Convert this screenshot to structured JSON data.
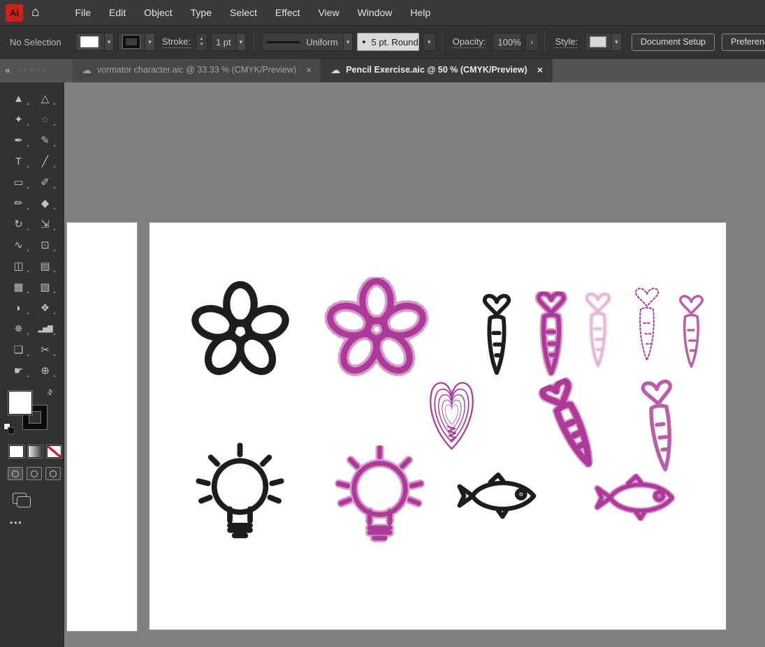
{
  "app": {
    "logo": "Ai",
    "home_glyph": "⌂"
  },
  "colors": {
    "menubar_bg": "#393939",
    "controlbar_bg": "#323232",
    "tabbar_bg": "#535353",
    "panel_bg": "#323232",
    "pasteboard_bg": "#7f7f7f",
    "artboard_bg": "#ffffff",
    "artwork_black": "#1d1d1b",
    "artwork_magenta": "#ad3a98",
    "artwork_pink": "#bb5ea9",
    "artwork_pink_faded": "#d49fca",
    "ai_logo_bg": "#c9251c"
  },
  "menubar": {
    "items": [
      "File",
      "Edit",
      "Object",
      "Type",
      "Select",
      "Effect",
      "View",
      "Window",
      "Help"
    ]
  },
  "control_bar": {
    "selection_status": "No Selection",
    "fill_swatch_color": "#ffffff",
    "stroke_swatch_color": "#000000",
    "stroke_label": "Stroke:",
    "stroke_weight": "1 pt",
    "width_profile": "Uniform",
    "brush_dot": "•",
    "brush_definition": "5 pt. Round",
    "opacity_label": "Opacity:",
    "opacity_value": "100%",
    "style_label": "Style:",
    "document_setup": "Document Setup",
    "preferences": "Preferences",
    "chevron": "▾",
    "spinner_up": "▴",
    "spinner_down": "▾",
    "more_arrow": "›"
  },
  "tab_bar": {
    "collapse": "«",
    "tabs": [
      {
        "icon": "☁",
        "label": "vormator character.aic @ 33.33 % (CMYK/Preview)",
        "close": "×",
        "active": false
      },
      {
        "icon": "☁",
        "label": "Pencil Exercise.aic @ 50 % (CMYK/Preview)",
        "close": "×",
        "active": true
      }
    ]
  },
  "toolbar": {
    "swap_icon": "⇄",
    "edit_toolbar": "•••",
    "tools": [
      {
        "name": "selection-tool",
        "glyph": "▲"
      },
      {
        "name": "direct-selection-tool",
        "glyph": "△"
      },
      {
        "name": "magic-wand-tool",
        "glyph": "✦"
      },
      {
        "name": "lasso-tool",
        "glyph": "◌"
      },
      {
        "name": "pen-tool",
        "glyph": "✒"
      },
      {
        "name": "curvature-tool",
        "glyph": "✎"
      },
      {
        "name": "type-tool",
        "glyph": "T"
      },
      {
        "name": "line-segment-tool",
        "glyph": "╱"
      },
      {
        "name": "rectangle-tool",
        "glyph": "▭"
      },
      {
        "name": "paintbrush-tool",
        "glyph": "✐"
      },
      {
        "name": "pencil-tool",
        "glyph": "✏"
      },
      {
        "name": "eraser-tool",
        "glyph": "◆"
      },
      {
        "name": "rotate-tool",
        "glyph": "↻"
      },
      {
        "name": "scale-tool",
        "glyph": "⇲"
      },
      {
        "name": "width-tool",
        "glyph": "∿"
      },
      {
        "name": "free-transform-tool",
        "glyph": "⊡"
      },
      {
        "name": "shape-builder-tool",
        "glyph": "◫"
      },
      {
        "name": "perspective-grid-tool",
        "glyph": "▤"
      },
      {
        "name": "mesh-tool",
        "glyph": "▦"
      },
      {
        "name": "gradient-tool",
        "glyph": "▧"
      },
      {
        "name": "eyedropper-tool",
        "glyph": "◗"
      },
      {
        "name": "blend-tool",
        "glyph": "❖"
      },
      {
        "name": "symbol-sprayer-tool",
        "glyph": "✵"
      },
      {
        "name": "column-graph-tool",
        "glyph": "▂▅▇"
      },
      {
        "name": "artboard-tool",
        "glyph": "❏"
      },
      {
        "name": "slice-tool",
        "glyph": "✂"
      },
      {
        "name": "hand-tool",
        "glyph": "☛"
      },
      {
        "name": "zoom-tool",
        "glyph": "⊕"
      }
    ]
  },
  "canvas": {
    "artwork": [
      {
        "name": "flower-icon-black",
        "color": "#1d1d1b",
        "style": "solid"
      },
      {
        "name": "flower-icon-magenta",
        "color": "#ad3a98",
        "style": "sketch"
      },
      {
        "name": "carrot-icon-black",
        "color": "#1d1d1b",
        "style": "solid"
      },
      {
        "name": "carrot-icon-magenta",
        "color": "#ad3a98",
        "style": "sketch"
      },
      {
        "name": "carrot-icon-pink-faded",
        "color": "#d49fca",
        "style": "faded"
      },
      {
        "name": "carrot-icon-dashed",
        "color": "#ad3a98",
        "style": "dashed-outline"
      },
      {
        "name": "carrot-icon-pink",
        "color": "#bb5ea9",
        "style": "thin"
      },
      {
        "name": "heart-scribble-icon",
        "color": "#ad3a98",
        "style": "concentric"
      },
      {
        "name": "carrot-icon-magenta-tilted",
        "color": "#ad3a98",
        "style": "dense"
      },
      {
        "name": "carrot-icon-pink-tilted",
        "color": "#bb5ea9",
        "style": "thin"
      },
      {
        "name": "lightbulb-icon-black",
        "color": "#1d1d1b",
        "style": "solid"
      },
      {
        "name": "lightbulb-icon-magenta",
        "color": "#ad3a98",
        "style": "sketch"
      },
      {
        "name": "fish-icon-black",
        "color": "#1d1d1b",
        "style": "solid"
      },
      {
        "name": "fish-icon-magenta",
        "color": "#ad3a98",
        "style": "sketch"
      }
    ]
  }
}
